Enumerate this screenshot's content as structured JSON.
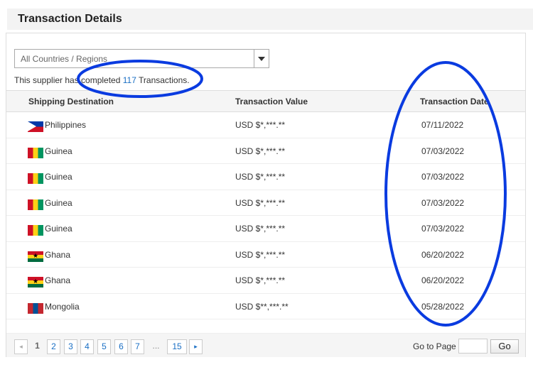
{
  "header": {
    "title": "Transaction Details"
  },
  "filter": {
    "selected": "All Countries / Regions"
  },
  "summary": {
    "prefix": "This supplier has completed ",
    "count": "117",
    "suffix": " Transactions."
  },
  "table": {
    "headers": [
      "Shipping Destination",
      "Transaction Value",
      "Transaction Date"
    ],
    "rows": [
      {
        "flag": "ph",
        "destination": "Philippines",
        "value": "USD $*,***.**",
        "date": "07/11/2022"
      },
      {
        "flag": "gn",
        "destination": "Guinea",
        "value": "USD $*,***.**",
        "date": "07/03/2022"
      },
      {
        "flag": "gn",
        "destination": "Guinea",
        "value": "USD $*,***.**",
        "date": "07/03/2022"
      },
      {
        "flag": "gn",
        "destination": "Guinea",
        "value": "USD $*,***.**",
        "date": "07/03/2022"
      },
      {
        "flag": "gn",
        "destination": "Guinea",
        "value": "USD $*,***.**",
        "date": "07/03/2022"
      },
      {
        "flag": "gh",
        "destination": "Ghana",
        "value": "USD $*,***.**",
        "date": "06/20/2022"
      },
      {
        "flag": "gh",
        "destination": "Ghana",
        "value": "USD $*,***.**",
        "date": "06/20/2022"
      },
      {
        "flag": "mn",
        "destination": "Mongolia",
        "value": "USD $**,***.**",
        "date": "05/28/2022"
      }
    ]
  },
  "pagination": {
    "prev": "◂",
    "current": "1",
    "pages": [
      "2",
      "3",
      "4",
      "5",
      "6",
      "7"
    ],
    "ellipsis": "...",
    "last": "15",
    "next": "▸",
    "goto_label": "Go to Page",
    "goto_value": "",
    "go_button": "Go"
  },
  "colors": {
    "annotation": "#0a3be0",
    "link": "#1a6fc4"
  }
}
